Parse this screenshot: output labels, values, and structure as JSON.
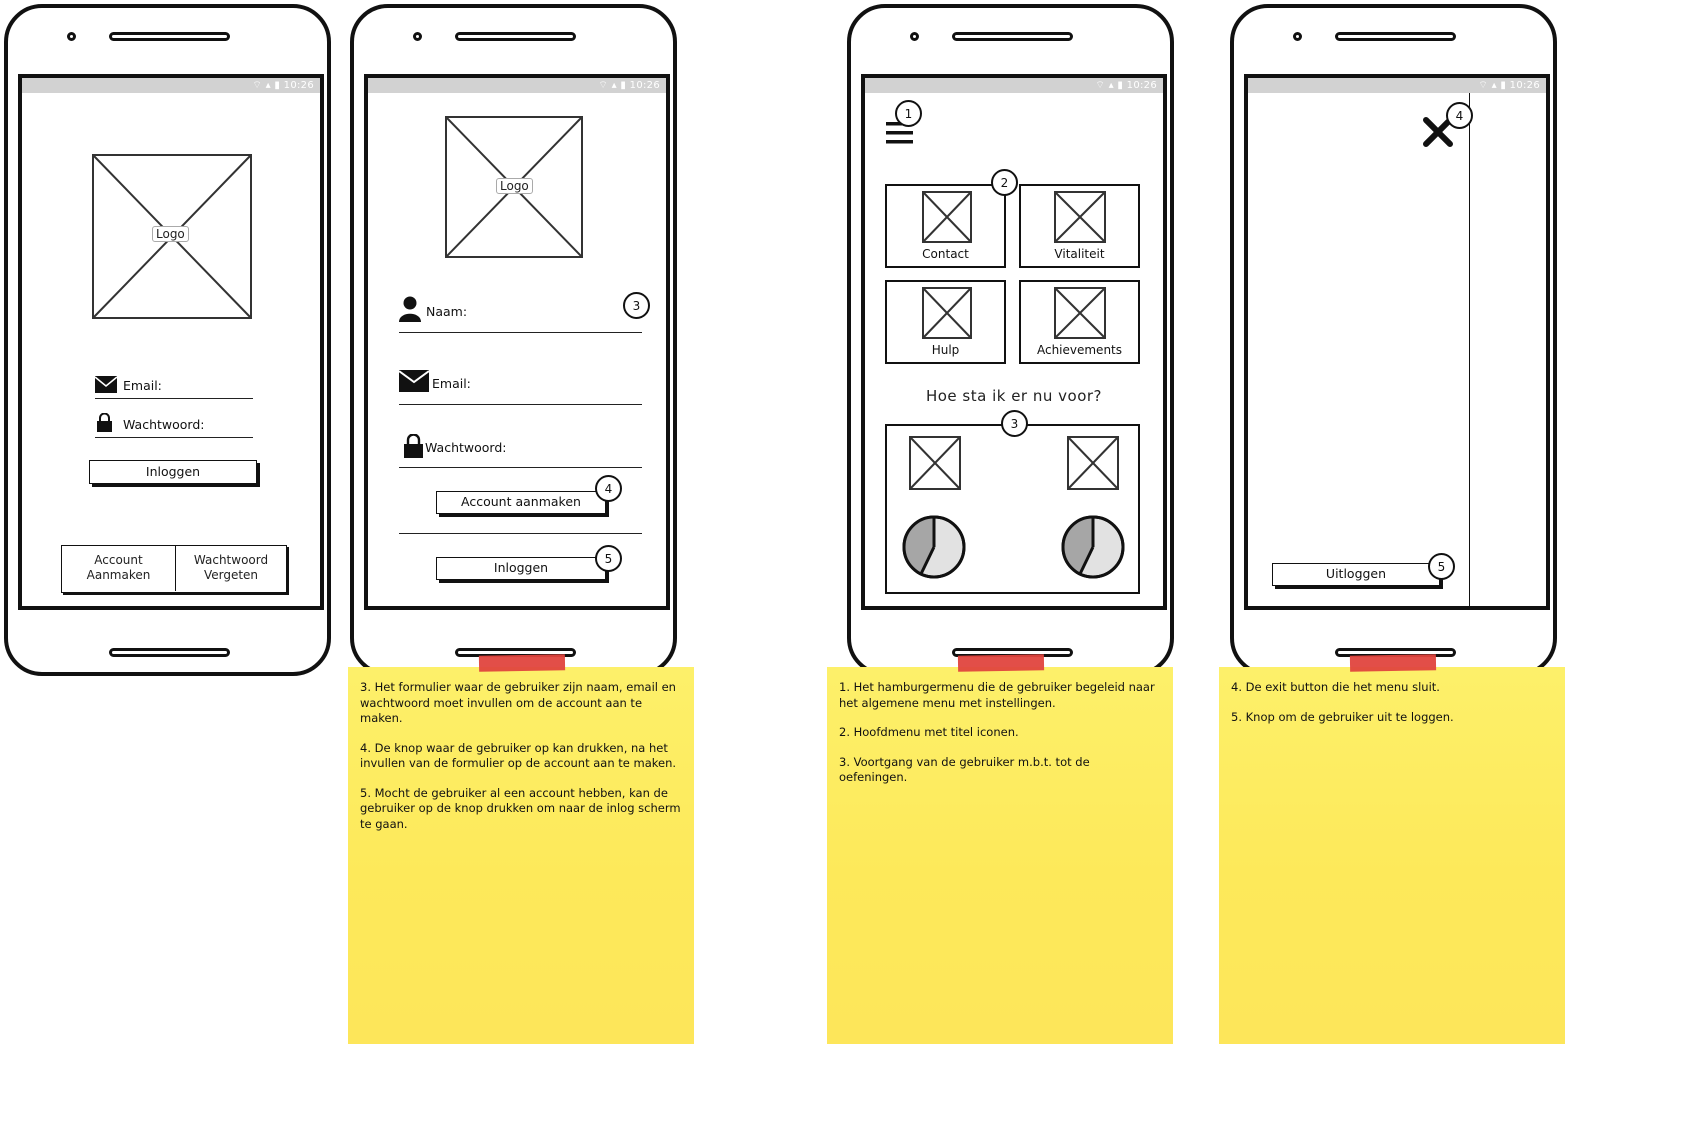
{
  "status_time": "10:26",
  "screen1": {
    "logo": "Logo",
    "email_label": "Email:",
    "password_label": "Wachtwoord:",
    "login_button": "Inloggen",
    "create_account_line1": "Account",
    "create_account_line2": "Aanmaken",
    "forgot_password_line1": "Wachtwoord",
    "forgot_password_line2": "Vergeten"
  },
  "screen2": {
    "logo": "Logo",
    "name_label": "Naam:",
    "email_label": "Email:",
    "password_label": "Wachtwoord:",
    "create_account_button": "Account aanmaken",
    "login_button": "Inloggen",
    "badges": [
      "3",
      "4",
      "5"
    ]
  },
  "screen3": {
    "badges": [
      "1",
      "2",
      "3"
    ],
    "tiles": [
      "Contact",
      "Vitaliteit",
      "Hulp",
      "Achievements"
    ],
    "progress_title": "Hoe sta ik er nu voor?"
  },
  "screen4": {
    "badges": [
      "4",
      "5"
    ],
    "logout_button": "Uitloggen"
  },
  "notes": {
    "note1": [
      "3. Het formulier waar de gebruiker zijn naam, email en wachtwoord moet invullen om de account aan te maken.",
      "4. De knop waar de gebruiker op kan drukken, na het invullen van de formulier op de account aan te maken.",
      "5. Mocht de gebruiker al een account hebben, kan de gebruiker op de knop drukken om naar de inlog scherm te gaan."
    ],
    "note2": [
      "1. Het hamburgermenu die de gebruiker begeleid naar het algemene menu met instellingen.",
      "2. Hoofdmenu met titel iconen.",
      "3. Voortgang van de gebruiker m.b.t. tot de oefeningen."
    ],
    "note3": [
      "4. De exit button die het menu sluit.",
      "5. Knop om de gebruiker uit te loggen."
    ]
  },
  "colors": {
    "status_bar": "#d2d2d2",
    "sticky_note": "#fde95a",
    "tape": "#e0453e",
    "pie_dark": "#a6a6a6",
    "pie_light": "#e2e2e2"
  }
}
